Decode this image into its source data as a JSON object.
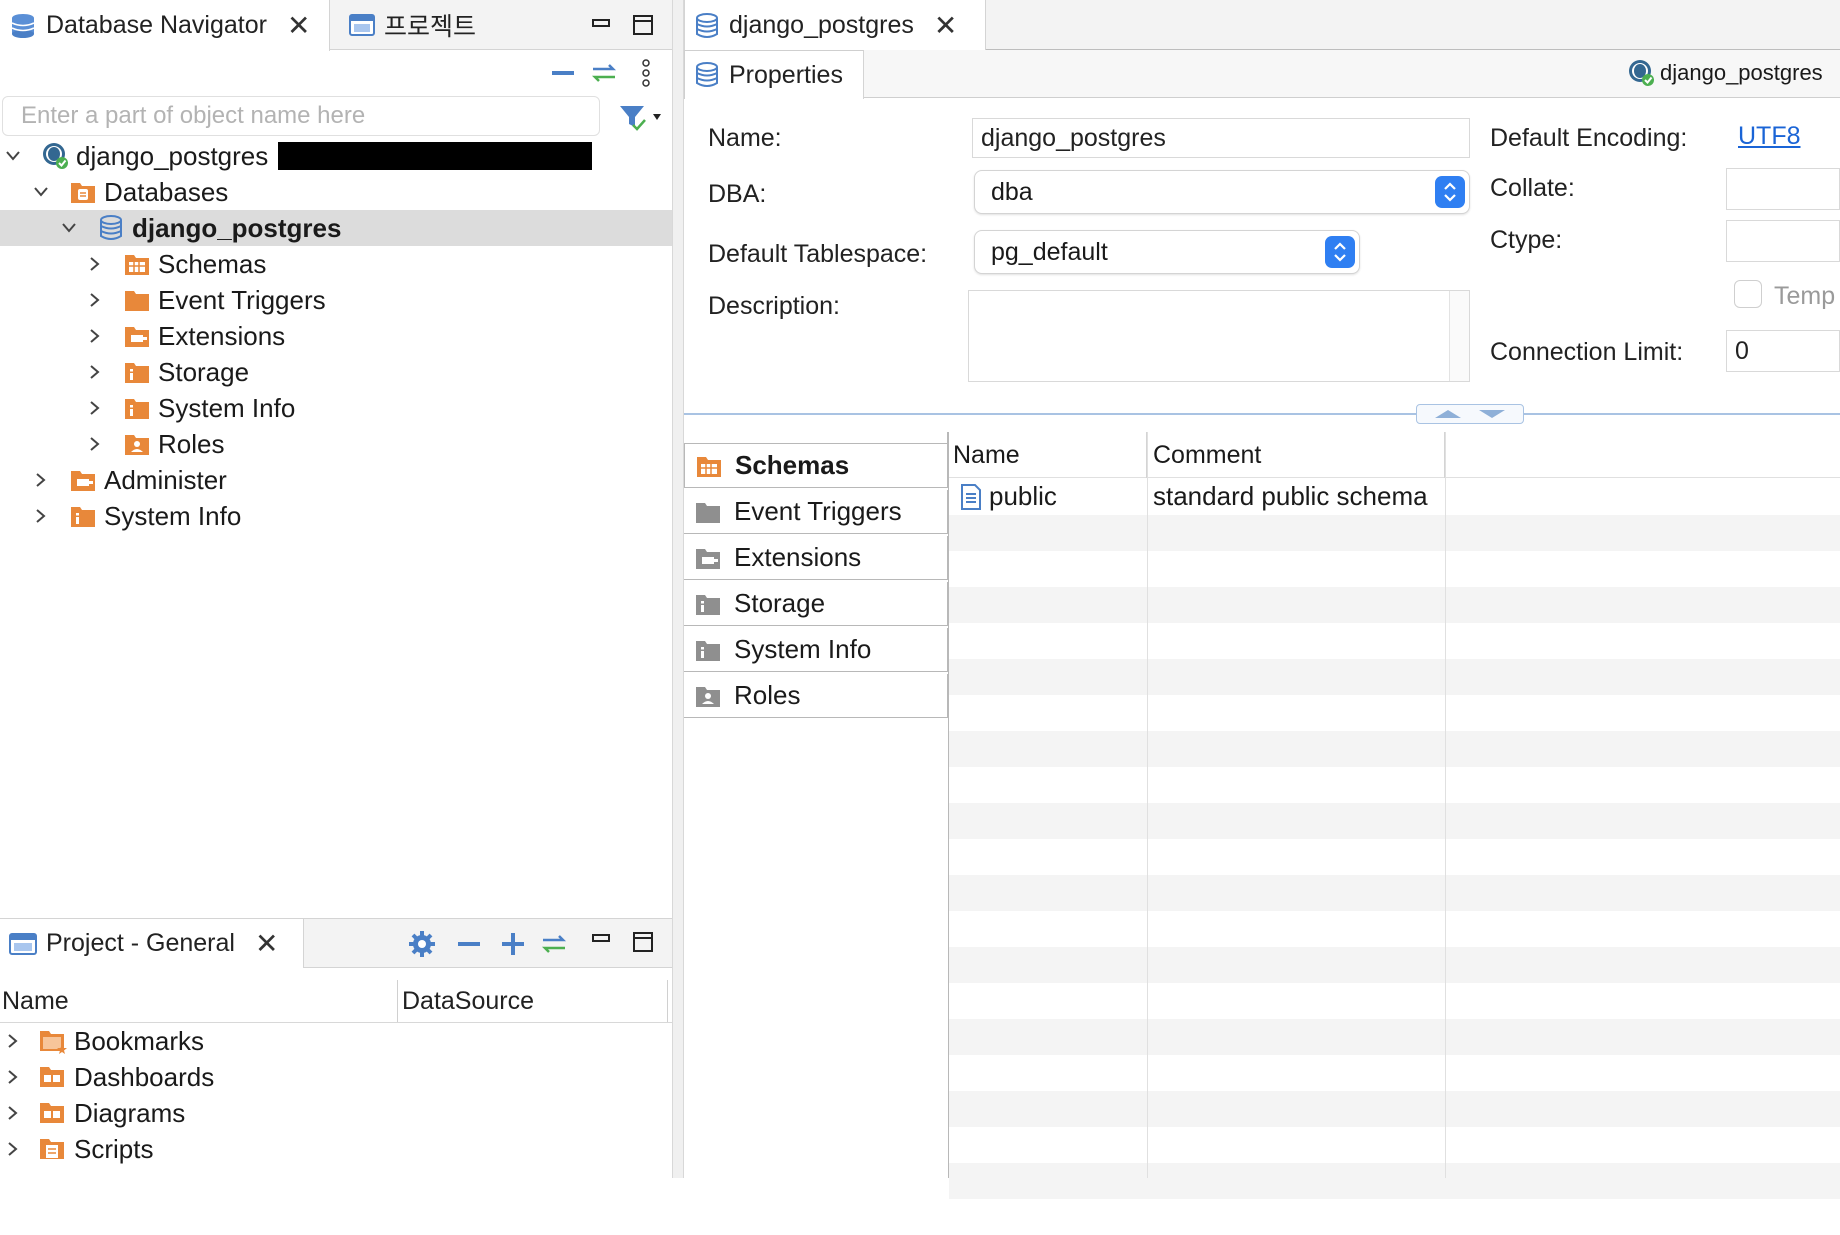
{
  "navigator": {
    "tab_label": "Database Navigator",
    "project_tab_label": "프로젝트",
    "filter_placeholder": "Enter a part of object name here",
    "tree": {
      "connection": "django_postgres",
      "databases": "Databases",
      "database": "django_postgres",
      "children": [
        "Schemas",
        "Event Triggers",
        "Extensions",
        "Storage",
        "System Info",
        "Roles"
      ],
      "administer": "Administer",
      "system_info": "System Info"
    }
  },
  "project": {
    "tab_label": "Project - General",
    "columns": [
      "Name",
      "DataSource"
    ],
    "items": [
      "Bookmarks",
      "Dashboards",
      "Diagrams",
      "Scripts"
    ]
  },
  "editor": {
    "tab_label": "django_postgres",
    "subtab_label": "Properties",
    "connection_badge": "django_postgres",
    "form": {
      "name_label": "Name:",
      "name_value": "django_postgres",
      "dba_label": "DBA:",
      "dba_value": "dba",
      "tablespace_label": "Default Tablespace:",
      "tablespace_value": "pg_default",
      "description_label": "Description:",
      "encoding_label": "Default Encoding:",
      "encoding_value": "UTF8",
      "collate_label": "Collate:",
      "ctype_label": "Ctype:",
      "template_label": "Temp",
      "connlimit_label": "Connection Limit:",
      "connlimit_value": "0"
    },
    "sections": [
      "Schemas",
      "Event Triggers",
      "Extensions",
      "Storage",
      "System Info",
      "Roles"
    ],
    "table": {
      "columns": [
        "Name",
        "Comment"
      ],
      "rows": [
        {
          "name": "public",
          "comment": "standard public schema"
        }
      ]
    }
  },
  "colors": {
    "accent_blue": "#2f7ff2",
    "folder_orange": "#e8883a",
    "link_blue": "#1a64d6"
  }
}
